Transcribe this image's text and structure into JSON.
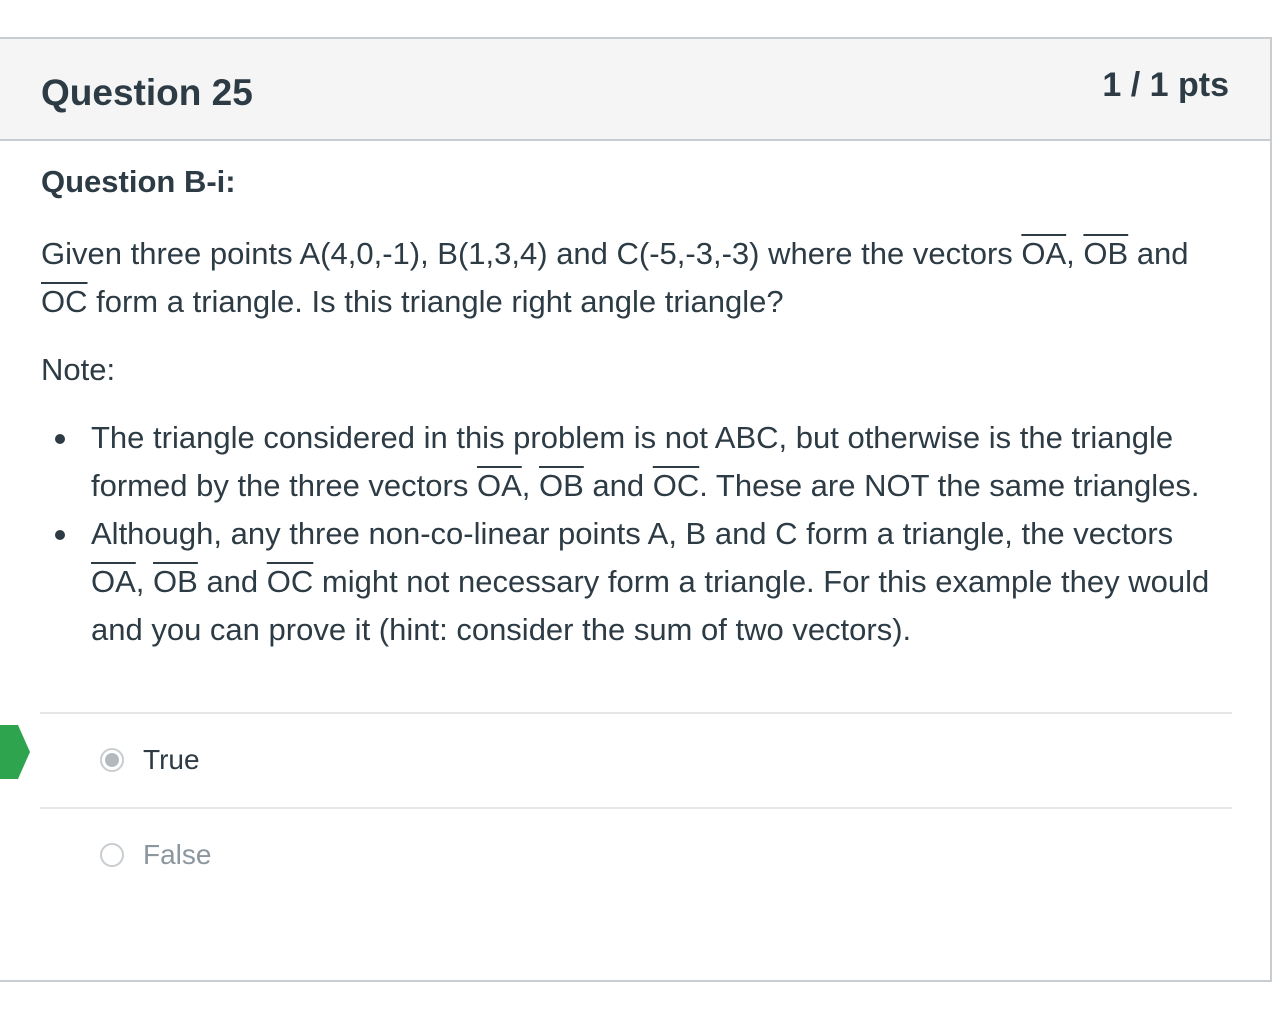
{
  "question": {
    "title": "Question 25",
    "points": "1 / 1 pts",
    "subheading": "Question B-i:",
    "para_part1": "Given three points A(4,0,-1), B(1,3,4) and C(-5,-3,-3) where the vectors ",
    "vec_oa": "OA",
    "comma": ", ",
    "vec_ob": "OB",
    "and": " and ",
    "vec_oc": "OC",
    "para_part2": " form a triangle. Is this triangle right angle triangle?",
    "note": "Note:",
    "bullet1_part1": "The triangle considered in this problem is not ABC, but otherwise is the triangle formed by the three vectors ",
    "bullet1_part2": ". These are NOT the same triangles.",
    "bullet2_part1": "Although, any three non-co-linear points A, B and C form a triangle, the vectors ",
    "bullet2_part2": " might not necessary form a triangle. For this example they would and you can prove it (hint: consider the sum of two vectors)."
  },
  "answers": [
    {
      "label": "True",
      "selected": true,
      "correct": true
    },
    {
      "label": "False",
      "selected": false,
      "correct": false
    }
  ],
  "colors": {
    "correct_flag": "#2ea44f",
    "text": "#2d3b45",
    "header_bg": "#f5f5f5"
  }
}
